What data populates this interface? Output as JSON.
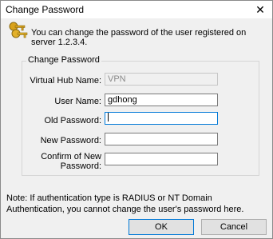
{
  "window": {
    "title": "Change Password",
    "close_glyph": "✕"
  },
  "header": {
    "icon": "keys-icon",
    "message": "You can change the password of the user registered on server 1.2.3.4."
  },
  "group": {
    "label": "Change Password",
    "fields": {
      "virtual_hub": {
        "label": "Virtual Hub Name:",
        "value": "VPN"
      },
      "user_name": {
        "label": "User Name:",
        "value": "gdhong"
      },
      "old_password": {
        "label": "Old Password:",
        "value": ""
      },
      "new_password": {
        "label": "New Password:",
        "value": ""
      },
      "confirm_password": {
        "label": "Confirm of New Password:",
        "value": ""
      }
    }
  },
  "note": "Note: If authentication type is RADIUS or NT Domain Authentication, you cannot change the user's password here.",
  "buttons": {
    "ok": "OK",
    "cancel": "Cancel"
  },
  "colors": {
    "focus": "#0078d7",
    "key_gold": "#d9a21b"
  }
}
